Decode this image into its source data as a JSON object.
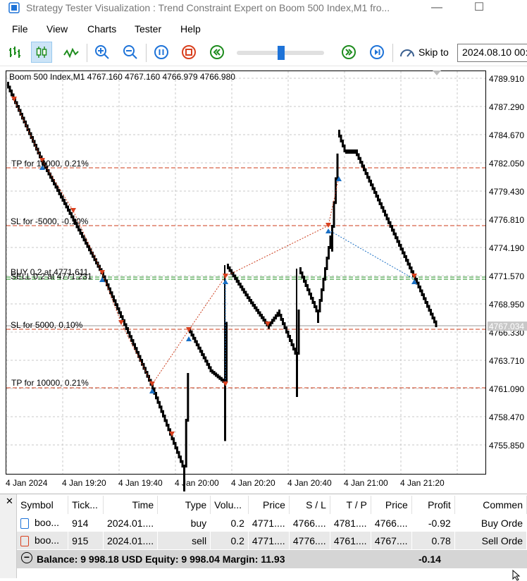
{
  "window": {
    "title": "Strategy Tester Visualization : Trend Constraint Expert on Boom 500 Index,M1 fro...",
    "minimize": "—",
    "maximize": "☐"
  },
  "menu": [
    "File",
    "View",
    "Charts",
    "Tester",
    "Help"
  ],
  "toolbar": {
    "skip_label": "Skip to",
    "skip_value": "2024.08.10 00:",
    "speed_fraction": 0.5
  },
  "chart": {
    "symbol_info": "Boom 500 Index,M1  4767.160 4767.160 4766.979 4766.980",
    "price_labels": [
      "4789.910",
      "4787.290",
      "4784.670",
      "4782.050",
      "4779.430",
      "4776.810",
      "4774.190",
      "4771.570",
      "4768.950",
      "4766.330",
      "4763.710",
      "4761.090",
      "4758.470",
      "4755.850"
    ],
    "current_price": "4767.034",
    "time_labels": [
      "4 Jan 2024",
      "4 Jan 19:20",
      "4 Jan 19:40",
      "4 Jan 20:00",
      "4 Jan 20:20",
      "4 Jan 20:40",
      "4 Jan 21:00",
      "4 Jan 21:20"
    ],
    "lines": {
      "tp_pos": "TP for 10000, 0.21%",
      "sl_neg": "SL for -5000, -0.10%",
      "buy": "BUY 0.2 at 4771.611",
      "sell": "SELL 0.2 at 4771.231",
      "sl_pos": "SL for  5000,  0.10%",
      "tp_low": "TP for 10000, 0.21%"
    },
    "colors": {
      "bull": "#000000",
      "sl_tp_line": "#cc3b1a",
      "order_line": "#1e8c1e",
      "sell_arrow": "#d9401e",
      "buy_arrow": "#1a6fc4"
    }
  },
  "trades": {
    "headers": [
      "Symbol",
      "Tick...",
      "Time",
      "Type",
      "Volu...",
      "Price",
      "S / L",
      "T / P",
      "Price",
      "Profit",
      "Commen"
    ],
    "rows": [
      [
        "boo...",
        "914",
        "2024.01....",
        "buy",
        "0.2",
        "4771....",
        "4766....",
        "4781....",
        "4766....",
        "-0.92",
        "Buy Orde"
      ],
      [
        "boo...",
        "915",
        "2024.01....",
        "sell",
        "0.2",
        "4771....",
        "4776....",
        "4761....",
        "4767....",
        "0.78",
        "Sell Orde"
      ]
    ],
    "balance": "Balance: 9 998.18 USD  Equity: 9 998.04  Margin: 11.93",
    "total_profit": "-0.14"
  }
}
